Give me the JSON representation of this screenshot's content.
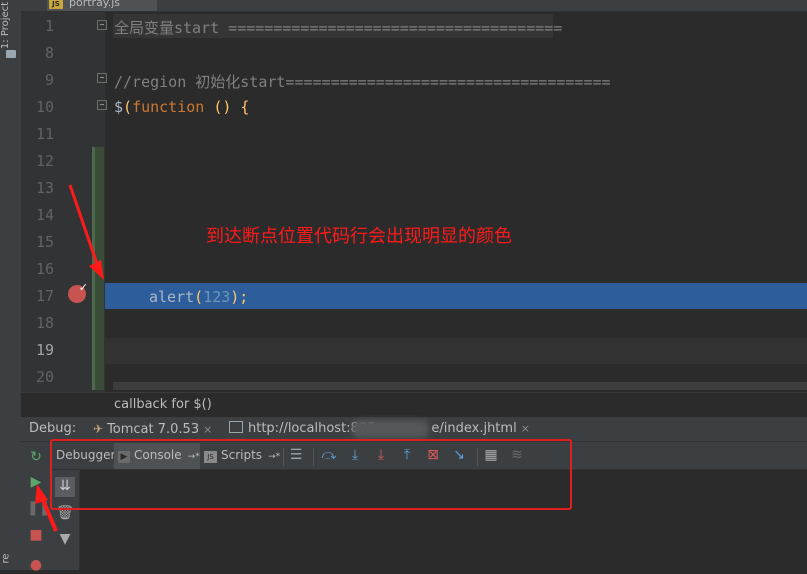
{
  "editor": {
    "file_tab": "portray.js",
    "file_tab_icon": "JS",
    "line_numbers": [
      "1",
      "8",
      "9",
      "10",
      "11",
      "12",
      "13",
      "14",
      "15",
      "16",
      "17",
      "18",
      "19",
      "20"
    ],
    "current_line": "19",
    "breakpoint_line": "17",
    "code": {
      "line1": "全局变量start =====================================",
      "line9_comment": "//region 初始化start====================================",
      "line10_dollar": "$",
      "line10_paren": "(",
      "line10_kw": "function",
      "line10_rest": " () {",
      "line17_fn": "alert",
      "line17_open": "(",
      "line17_num": "123",
      "line17_close": ");"
    },
    "breadcrumb": "callback for $()"
  },
  "annotation": {
    "text": "到达断点位置代码行会出现明显的颜色",
    "color": "#ff1a1a"
  },
  "debug_panel": {
    "label": "Debug:",
    "tabs": [
      {
        "label": "Tomcat 7.0.53",
        "icon": "tomcat-icon"
      },
      {
        "label": "http://localhost:808",
        "label_suffix": "e/index.jhtml",
        "icon": "browser-icon"
      }
    ],
    "close_glyph": "×",
    "subtabs": [
      {
        "label": "Debugger",
        "icon": null
      },
      {
        "label": "Console",
        "icon": "console-icon"
      },
      {
        "label": "Scripts",
        "icon": "js-scripts-icon"
      }
    ],
    "pin_glyph": "→*",
    "toolbar_icons": [
      "show-execution-point-icon",
      "step-over-icon",
      "step-into-icon",
      "force-step-into-icon",
      "step-out-icon",
      "drop-frame-icon",
      "run-to-cursor-icon",
      "evaluate-expression-icon",
      "trace-icon"
    ],
    "side_icons": [
      "rerun-icon",
      "resume-icon",
      "pause-icon",
      "stop-icon",
      "view-breakpoints-icon"
    ],
    "console_icons": [
      "scroll-to-end-icon",
      "clear-all-icon",
      "filter-icon"
    ]
  },
  "left_strip": {
    "project_label": "1: Project",
    "bottom_label": "re"
  },
  "colors": {
    "execution_line": "#2d5d9b",
    "highlight_box": "#e02020",
    "breakpoint": "#c75450"
  }
}
